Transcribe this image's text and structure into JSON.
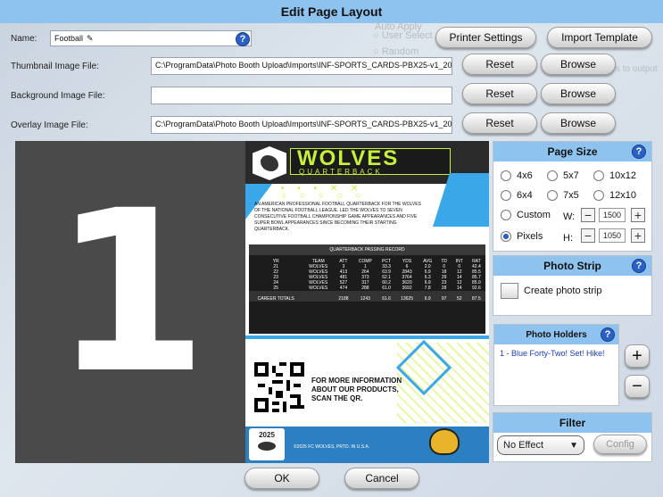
{
  "window": {
    "title": "Edit Page Layout"
  },
  "form": {
    "name_label": "Name:",
    "name_value": "Football",
    "thumb_label": "Thumbnail Image File:",
    "thumb_value": "C:\\ProgramData\\Photo Booth Upload\\Imports\\INF-SPORTS_CARDS-PBX25-v1_2025-03-07_",
    "bg_label": "Background Image File:",
    "bg_value": "",
    "overlay_label": "Overlay Image File:",
    "overlay_value": "C:\\ProgramData\\Photo Booth Upload\\Imports\\INF-SPORTS_CARDS-PBX25-v1_2025-03-07_"
  },
  "buttons": {
    "printer_settings": "Printer Settings",
    "import_template": "Import Template",
    "reset": "Reset",
    "browse": "Browse",
    "ok": "OK",
    "cancel": "Cancel",
    "config": "Config",
    "add": "+",
    "remove": "−"
  },
  "preview": {
    "holder_number": "1"
  },
  "card": {
    "team": "WOLVES",
    "position": "QUARTERBACK",
    "bio": "AN AMERICAN PROFESSIONAL FOOTBALL QUARTERBACK FOR THE WOLVES OF THE NATIONAL FOOTBALL LEAGUE. LED THE WOLVES TO SEVEN CONSECUTIVE FOOTBALL CHAMPIONSHIP GAME APPEARANCES AND FIVE SUPER BOWL APPEARANCES SINCE BECOMING THEIR STARTING QUARTERBACK.",
    "stats_title": "QUARTERBACK PASSING RECORD",
    "stats_headers": [
      "YR",
      "TEAM",
      "ATT",
      "COMP",
      "PCT",
      "YDS",
      "AVG",
      "TD",
      "INT",
      "RAT"
    ],
    "stats_rows": [
      [
        "21",
        "WOLVES",
        "3",
        "1",
        "33.3",
        "6",
        "2.0",
        "0",
        "0",
        "42.4"
      ],
      [
        "22",
        "WOLVES",
        "413",
        "264",
        "63.9",
        "2843",
        "6.9",
        "18",
        "12",
        "85.5"
      ],
      [
        "23",
        "WOLVES",
        "481",
        "373",
        "62.1",
        "3764",
        "6.3",
        "29",
        "14",
        "85.7"
      ],
      [
        "24",
        "WOLVES",
        "527",
        "317",
        "60.2",
        "3620",
        "6.9",
        "23",
        "12",
        "85.9"
      ],
      [
        "25",
        "WOLVES",
        "474",
        "288",
        "61.0",
        "3692",
        "7.8",
        "28",
        "14",
        "92.6"
      ]
    ],
    "career_row": [
      "CAREER TOTALS",
      "",
      "2188",
      "1243",
      "61.6",
      "13625",
      "6.9",
      "97",
      "52",
      "87.5"
    ],
    "qr_text": "FOR MORE INFORMATION ABOUT OUR PRODUCTS, SCAN THE QR.",
    "year": "2025",
    "footer": "©2025 FC WOLVES, PRTD. IN U.S.A."
  },
  "page_size": {
    "title": "Page Size",
    "options": [
      "4x6",
      "5x7",
      "10x12",
      "6x4",
      "7x5",
      "12x10"
    ],
    "custom_label": "Custom",
    "pixels_label": "Pixels",
    "w_label": "W:",
    "h_label": "H:",
    "width": "1500",
    "height": "1050"
  },
  "photo_strip": {
    "title": "Photo Strip",
    "checkbox_label": "Create photo strip"
  },
  "photo_holders": {
    "title": "Photo Holders",
    "items": [
      "1 - Blue Forty-Two! Set! Hike!"
    ]
  },
  "filter": {
    "title": "Filter",
    "selected": "No Effect"
  },
  "background_ghost": {
    "auto_apply": "Auto Apply",
    "user_select": "User Select",
    "random": "Random",
    "output": "s to output"
  },
  "colors": {
    "accent": "#8ec3f0",
    "help": "#2b60c4",
    "card_lime": "#c8f03a",
    "card_blue": "#3aa8e8",
    "card_dark": "#1c1c1c"
  }
}
